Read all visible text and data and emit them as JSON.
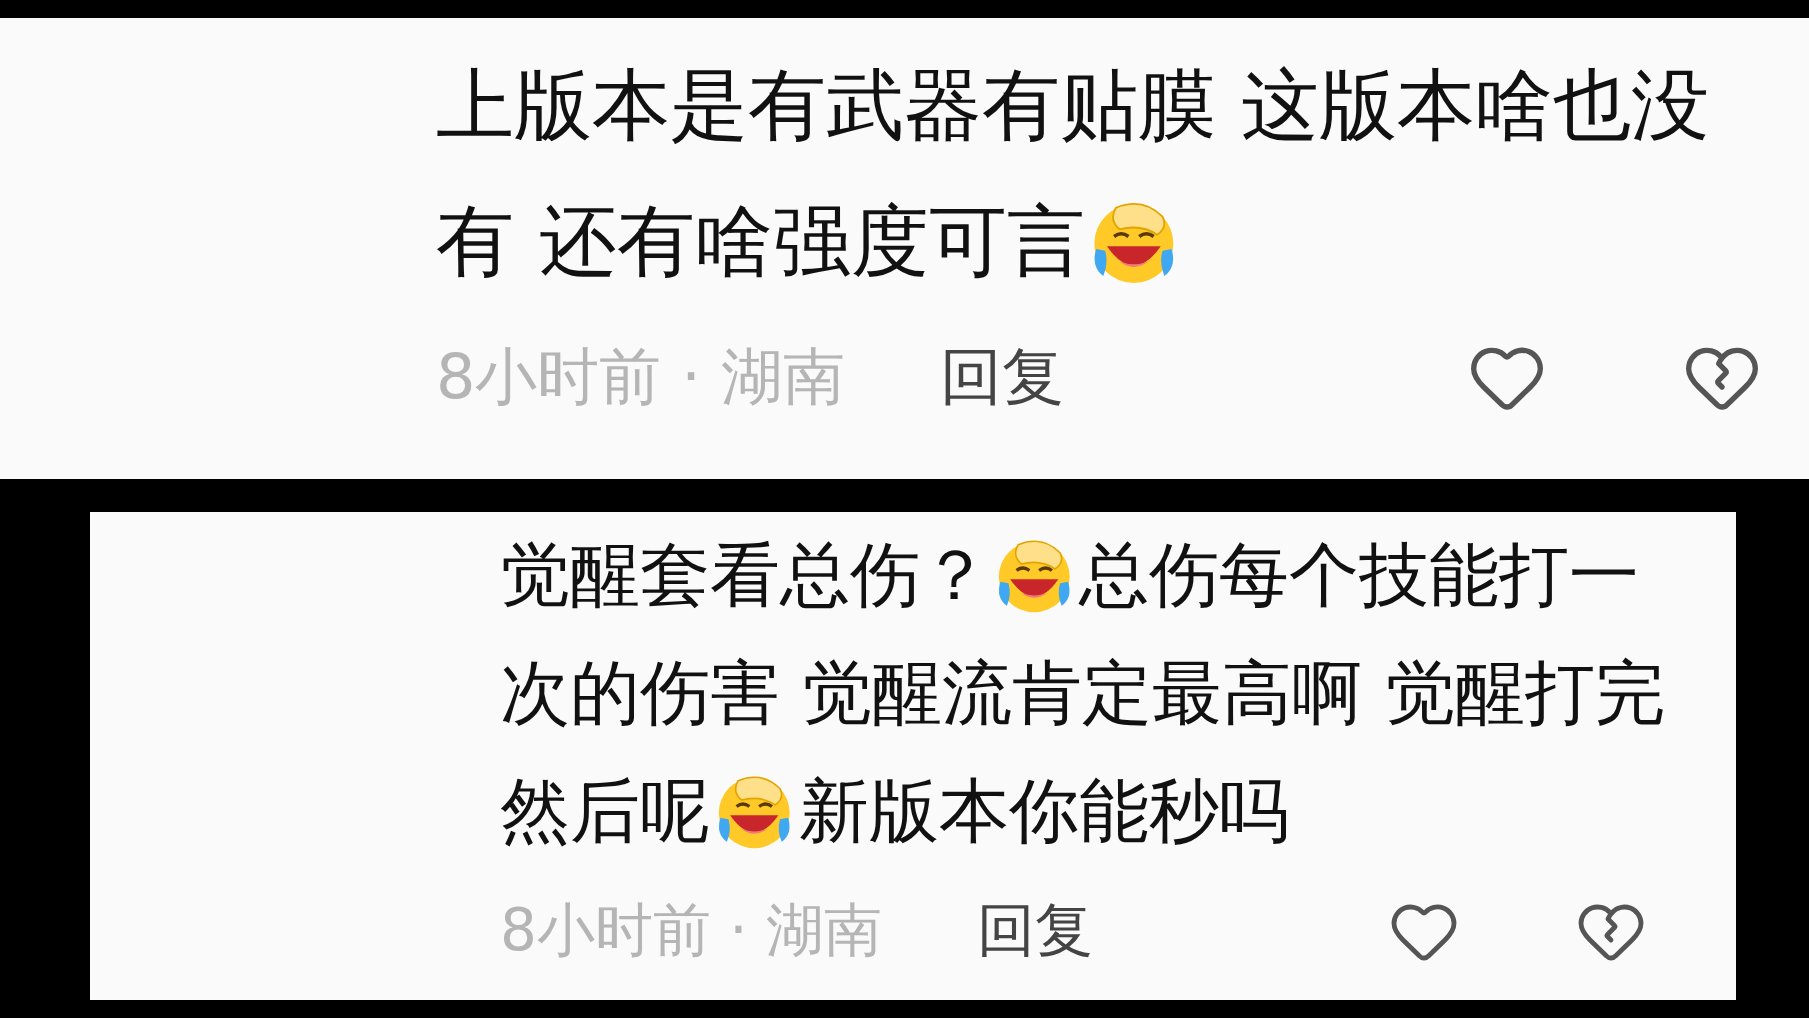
{
  "comments": [
    {
      "lines": [
        [
          {
            "kind": "text",
            "text": "上版本是有武器有贴膜 这版本啥也没"
          }
        ],
        [
          {
            "kind": "text",
            "text": "有 还有啥强度可言"
          },
          {
            "kind": "emoji"
          }
        ]
      ],
      "meta": "8小时前 · 湖南",
      "reply": "回复",
      "liked": false
    },
    {
      "lines": [
        [
          {
            "kind": "text",
            "text": "觉醒套看总伤？"
          },
          {
            "kind": "emoji"
          },
          {
            "kind": "text",
            "text": "总伤每个技能打一"
          }
        ],
        [
          {
            "kind": "text",
            "text": "次的伤害 觉醒流肯定最高啊 觉醒打完"
          }
        ],
        [
          {
            "kind": "text",
            "text": "然后呢"
          },
          {
            "kind": "emoji"
          },
          {
            "kind": "text",
            "text": "新版本你能秒吗"
          }
        ]
      ],
      "meta": "8小时前 · 湖南",
      "reply": "回复",
      "liked": false
    }
  ]
}
